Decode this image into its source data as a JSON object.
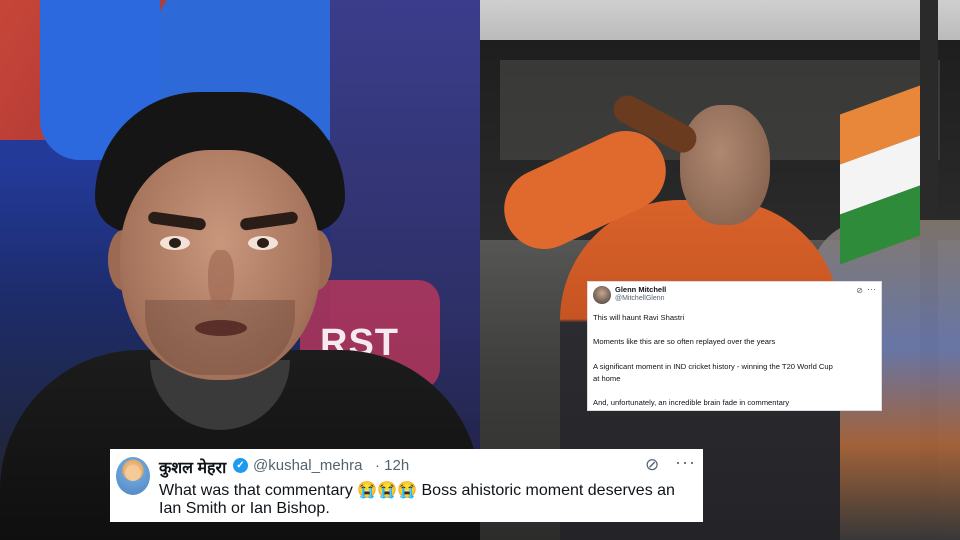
{
  "small_tweet": {
    "name": "Glenn Mitchell",
    "handle": "@MitchellGlenn",
    "lines": [
      "This will haunt Ravi Shastri",
      "Moments like this are so often replayed over the years",
      "A significant moment in IND cricket history - winning the T20 World Cup",
      "at home",
      "And, unfortunately, an incredible brain fade in commentary"
    ]
  },
  "main_tweet": {
    "name": "कुशल मेहरा",
    "handle": "@kushal_mehra",
    "time": "· 12h",
    "text_line1": "What was that commentary 😭😭😭 Boss ahistoric moment deserves an",
    "text_line2": "Ian Smith or Ian Bishop."
  },
  "left_photo": {
    "sign_text": "RST"
  },
  "icons": {
    "grok": "grok-icon",
    "more": "more-icon",
    "verified": "verified-icon"
  },
  "colors": {
    "verified": "#1d9bf0",
    "text_secondary": "#536471"
  }
}
